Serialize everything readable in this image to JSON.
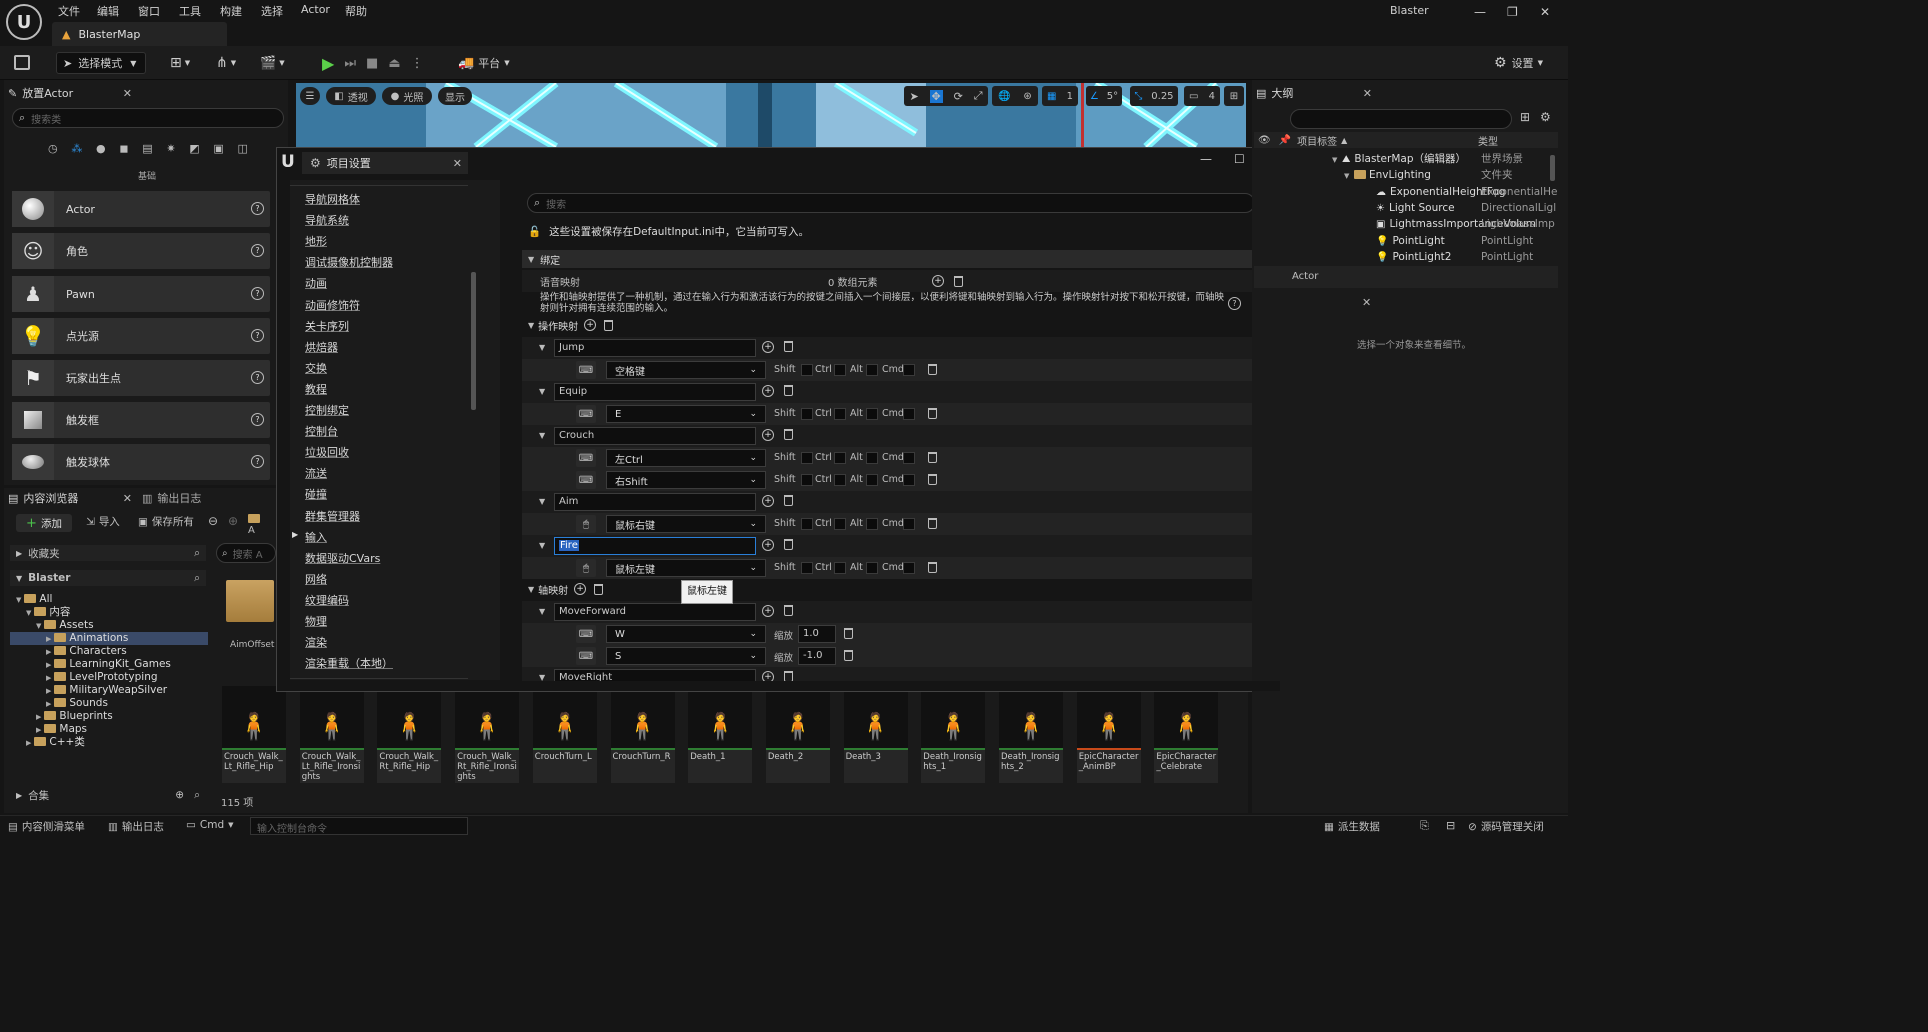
{
  "menu": [
    "文件",
    "编辑",
    "窗口",
    "工具",
    "构建",
    "选择",
    "Actor",
    "帮助"
  ],
  "project_name": "Blaster",
  "level_tab": "BlasterMap",
  "toolbar": {
    "mode": "选择模式",
    "platform": "平台",
    "settings": "设置"
  },
  "viewport": {
    "perspective": "透视",
    "lit": "光照",
    "show": "显示",
    "grid": "1",
    "angle": "5°",
    "scale": "0.25",
    "camera": "4"
  },
  "place_actor": {
    "title": "放置Actor",
    "search_placeholder": "搜索类",
    "category": "基础",
    "items": [
      "Actor",
      "角色",
      "Pawn",
      "点光源",
      "玩家出生点",
      "触发框",
      "触发球体"
    ]
  },
  "content_browser": {
    "tab": "内容浏览器",
    "output_tab": "输出日志",
    "add": "添加",
    "import": "导入",
    "save_all": "保存所有",
    "favorites": "收藏夹",
    "root": "Blaster",
    "tree": [
      {
        "label": "All",
        "indent": 0
      },
      {
        "label": "内容",
        "indent": 1
      },
      {
        "label": "Assets",
        "indent": 2
      },
      {
        "label": "Animations",
        "indent": 3,
        "selected": true
      },
      {
        "label": "Characters",
        "indent": 3
      },
      {
        "label": "LearningKit_Games",
        "indent": 3
      },
      {
        "label": "LevelPrototyping",
        "indent": 3
      },
      {
        "label": "MilitaryWeapSilver",
        "indent": 3
      },
      {
        "label": "Sounds",
        "indent": 3
      },
      {
        "label": "Blueprints",
        "indent": 2
      },
      {
        "label": "Maps",
        "indent": 2
      },
      {
        "label": "C++类",
        "indent": 1
      }
    ],
    "search_placeholder": "搜索 A",
    "folder_label": "AimOffset",
    "collections": "合集",
    "count": "115 项",
    "assets": [
      "Crouch_Walk_Lt_Rifle_Hip",
      "Crouch_Walk_Lt_Rifle_Ironsights",
      "Crouch_Walk_Rt_Rifle_Hip",
      "Crouch_Walk_Rt_Rifle_Ironsights",
      "CrouchTurn_L",
      "CrouchTurn_R",
      "Death_1",
      "Death_2",
      "Death_3",
      "Death_Ironsights_1",
      "Death_Ironsights_2",
      "EpicCharacter_AnimBP",
      "EpicCharacter_Celebrate"
    ]
  },
  "dialog": {
    "title": "项目设置",
    "nav": [
      "导航网格体",
      "导航系统",
      "地形",
      "调试摄像机控制器",
      "动画",
      "动画修饰符",
      "关卡序列",
      "烘焙器",
      "交换",
      "教程",
      "控制绑定",
      "控制台",
      "垃圾回收",
      "流送",
      "碰撞",
      "群集管理器",
      "输入",
      "数据驱动CVars",
      "网络",
      "纹理编码",
      "物理",
      "渲染",
      "渲染重载（本地）"
    ],
    "search_placeholder": "搜索",
    "notice": "这些设置被保存在DefaultInput.ini中，它当前可写入。",
    "section": "绑定",
    "speech_label": "语音映射",
    "speech_value": "0 数组元素",
    "description": "操作和轴映射提供了一种机制，通过在输入行为和激活该行为的按键之间插入一个间接层，以便利将键和轴映射到输入行为。操作映射针对按下和松开按键，而轴映射则针对拥有连续范围的输入。",
    "action_header": "操作映射",
    "axis_header": "轴映射",
    "modifiers": [
      "Shift",
      "Ctrl",
      "Alt",
      "Cmd"
    ],
    "scale_label": "缩放",
    "actions": [
      {
        "name": "Jump",
        "keys": [
          {
            "key": "空格键",
            "device": "keyboard"
          }
        ]
      },
      {
        "name": "Equip",
        "keys": [
          {
            "key": "E",
            "device": "keyboard"
          }
        ]
      },
      {
        "name": "Crouch",
        "keys": [
          {
            "key": "左Ctrl",
            "device": "keyboard"
          },
          {
            "key": "右Shift",
            "device": "keyboard"
          }
        ]
      },
      {
        "name": "Aim",
        "keys": [
          {
            "key": "鼠标右键",
            "device": "mouse"
          }
        ]
      },
      {
        "name": "Fire",
        "keys": [
          {
            "key": "鼠标左键",
            "device": "mouse"
          }
        ],
        "editing": true
      }
    ],
    "axes": [
      {
        "name": "MoveForward",
        "keys": [
          {
            "key": "W",
            "scale": "1.0"
          },
          {
            "key": "S",
            "scale": "-1.0"
          }
        ]
      },
      {
        "name": "MoveRight",
        "keys": []
      }
    ],
    "tooltip": "鼠标左键"
  },
  "outliner": {
    "title": "大纲",
    "col_label": "项目标签",
    "col_type": "类型",
    "rows": [
      {
        "label": "BlasterMap（编辑器）",
        "type": "世界场景",
        "indent": 0
      },
      {
        "label": "EnvLighting",
        "type": "文件夹",
        "indent": 1
      },
      {
        "label": "ExponentialHeightFog",
        "type": "ExponentialHe",
        "indent": 2
      },
      {
        "label": "Light Source",
        "type": "DirectionalLigl",
        "indent": 2
      },
      {
        "label": "LightmassImportanceVolum",
        "type": "LightmassImp",
        "indent": 2
      },
      {
        "label": "PointLight",
        "type": "PointLight",
        "indent": 2
      },
      {
        "label": "PointLight2",
        "type": "PointLight",
        "indent": 2
      }
    ],
    "footer": "Actor",
    "details_empty": "选择一个对象来查看细节。"
  },
  "status": {
    "drawer": "内容侧滑菜单",
    "output": "输出日志",
    "cmd": "Cmd",
    "console_placeholder": "输入控制台命令",
    "derived": "派生数据",
    "source_control": "源码管理关闭"
  }
}
